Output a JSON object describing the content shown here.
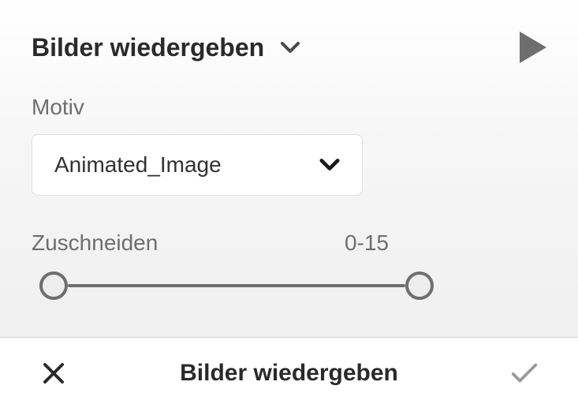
{
  "header": {
    "title": "Bilder wiedergeben"
  },
  "motif": {
    "label": "Motiv",
    "selected": "Animated_Image"
  },
  "crop": {
    "label": "Zuschneiden",
    "range_label": "0-15"
  },
  "footer": {
    "title": "Bilder wiedergeben"
  }
}
